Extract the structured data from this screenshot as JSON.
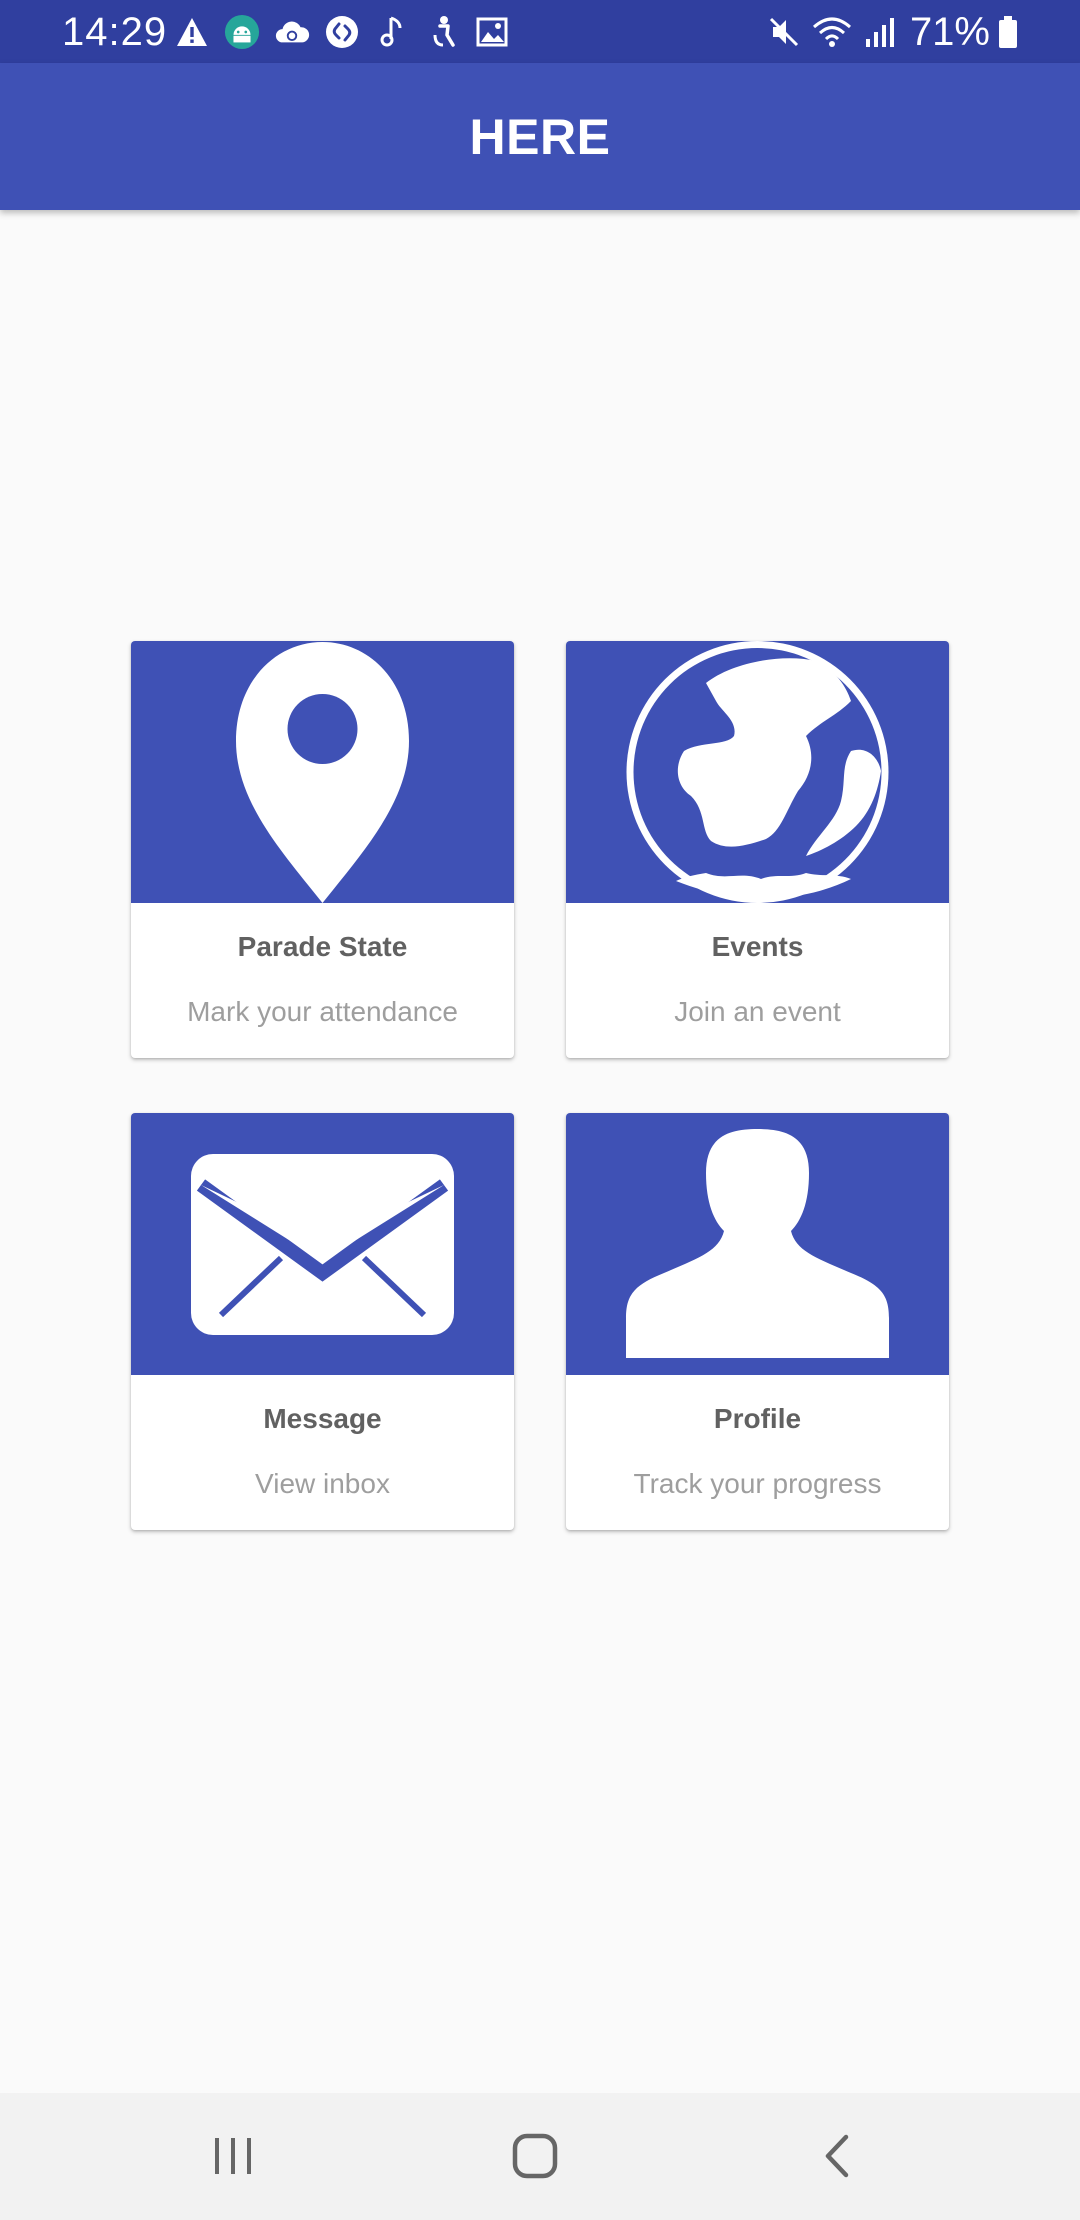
{
  "status_bar": {
    "time": "14:29",
    "battery_percent": "71%",
    "left_icons": [
      "warning-icon",
      "android-icon",
      "cloud-sync-icon",
      "shazam-icon",
      "music-note-icon",
      "accessibility-icon",
      "image-icon"
    ],
    "right_icons": [
      "mute-icon",
      "wifi-icon",
      "signal-icon",
      "battery-icon"
    ]
  },
  "app_bar": {
    "title": "HERE"
  },
  "cards": [
    {
      "title": "Parade State",
      "subtitle": "Mark your attendance",
      "icon": "location-pin-icon"
    },
    {
      "title": "Events",
      "subtitle": "Join an event",
      "icon": "globe-icon"
    },
    {
      "title": "Message",
      "subtitle": "View inbox",
      "icon": "envelope-icon"
    },
    {
      "title": "Profile",
      "subtitle": "Track your progress",
      "icon": "person-icon"
    }
  ],
  "nav_bar": {
    "buttons": [
      "recent-apps-icon",
      "home-icon",
      "back-icon"
    ]
  },
  "colors": {
    "status_bar": "#303f9f",
    "primary": "#3f51b5",
    "background": "#fafafa",
    "card_title": "#616161",
    "card_subtitle": "#9e9e9e"
  }
}
